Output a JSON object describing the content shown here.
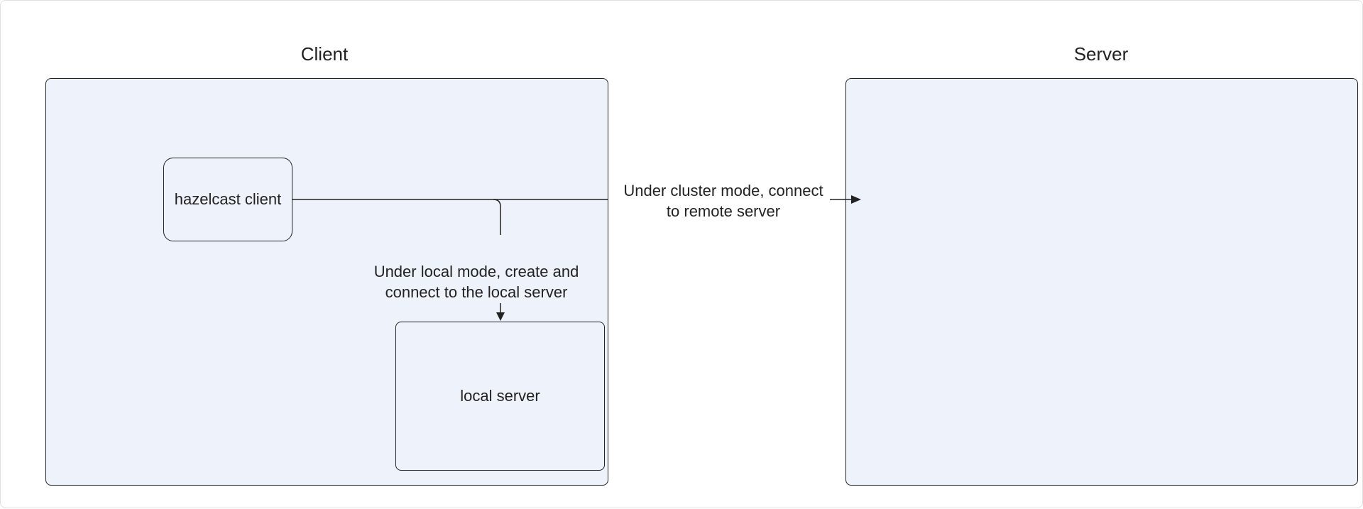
{
  "titles": {
    "client": "Client",
    "server": "Server"
  },
  "nodes": {
    "hazelcast_client": "hazelcast client",
    "local_server": "local server"
  },
  "labels": {
    "cluster_mode": "Under cluster mode, connect to remote server",
    "local_mode": "Under local mode, create and connect to the local server"
  }
}
